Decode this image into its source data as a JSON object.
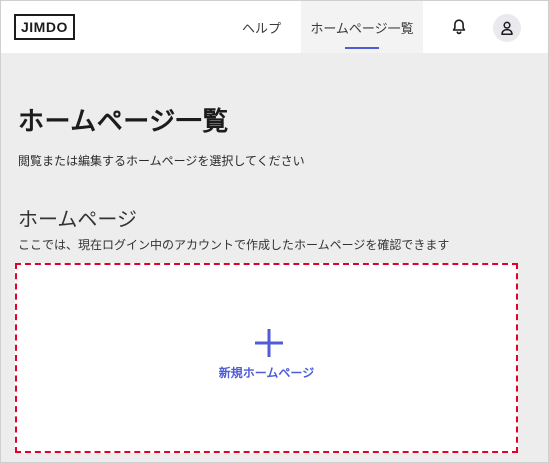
{
  "header": {
    "logo_text": "JIMDO",
    "nav": {
      "help_label": "ヘルプ",
      "sites_label": "ホームページ一覧"
    },
    "icons": {
      "notifications": "bell-icon",
      "account": "user-icon"
    }
  },
  "main": {
    "title": "ホームページ一覧",
    "description": "閲覧または編集するホームページを選択してください",
    "section": {
      "title": "ホームページ",
      "description": "ここでは、現在ログイン中のアカウントで作成したホームページを確認できます"
    },
    "new_site": {
      "label": "新規ホームページ",
      "icon": "plus-icon"
    }
  },
  "colors": {
    "accent": "#4f5cd6",
    "highlight_border": "#e4002b",
    "background": "#ededed"
  }
}
